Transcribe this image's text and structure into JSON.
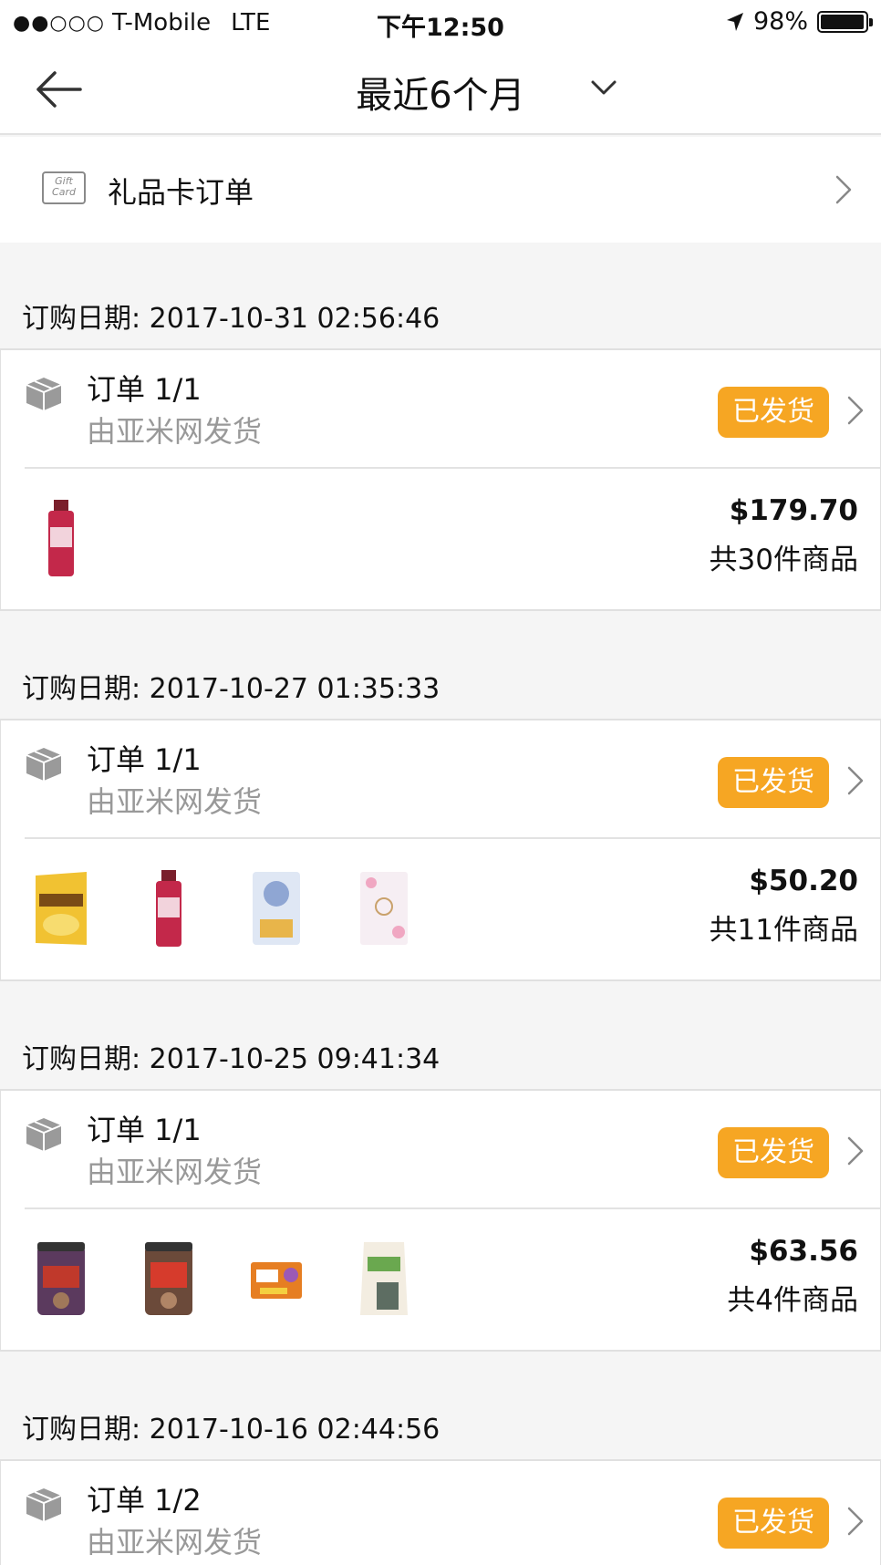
{
  "status_bar": {
    "signal": "●●○○○",
    "carrier": "T-Mobile",
    "network": "LTE",
    "time": "下午12:50",
    "battery": "98%",
    "battery_level": 0.98
  },
  "nav": {
    "back_icon": "arrow-left-icon",
    "title": "最近6个月",
    "dropdown_icon": "chevron-down-icon"
  },
  "gift_card": {
    "icon_text": "Gift Card",
    "label": "礼品卡订单"
  },
  "orders": [
    {
      "date": "订购日期: 2017-10-31 02:56:46",
      "title": "订单 1/1",
      "seller": "由亚米网发货",
      "status": "已发货",
      "price": "$179.70",
      "count": "共30件商品",
      "items": [
        "red-drink-bottle"
      ]
    },
    {
      "date": "订购日期: 2017-10-27 01:35:33",
      "title": "订单 1/1",
      "seller": "由亚米网发货",
      "status": "已发货",
      "price": "$50.20",
      "count": "共11件商品",
      "items": [
        "honey-butter-chips",
        "red-drink-bottle",
        "snack-bag-blue",
        "floral-pack"
      ]
    },
    {
      "date": "订购日期: 2017-10-25 09:41:34",
      "title": "订单 1/1",
      "seller": "由亚米网发货",
      "status": "已发货",
      "price": "$63.56",
      "count": "共4件商品",
      "items": [
        "snack-jar-purple",
        "snack-jar-red",
        "diet-box",
        "green-juice-bag"
      ]
    },
    {
      "date": "订购日期: 2017-10-16 02:44:56",
      "title": "订单 1/2",
      "seller": "由亚米网发货",
      "status": "已发货"
    }
  ],
  "colors": {
    "badge": "#f6a623",
    "muted_text": "#999999",
    "background": "#f5f5f5"
  }
}
